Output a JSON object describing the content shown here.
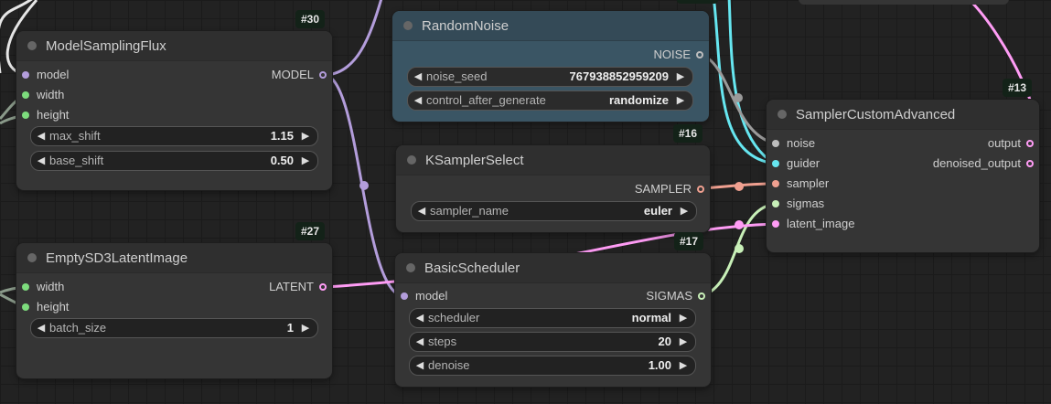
{
  "nodes": {
    "model_sampling_flux": {
      "title": "ModelSamplingFlux",
      "id": "#30",
      "inputs": [
        "model",
        "width",
        "height"
      ],
      "output": "MODEL",
      "widgets": [
        {
          "name": "max_shift",
          "value": "1.15"
        },
        {
          "name": "base_shift",
          "value": "0.50"
        }
      ]
    },
    "random_noise": {
      "title": "RandomNoise",
      "output": "NOISE",
      "widgets": [
        {
          "name": "noise_seed",
          "value": "767938852959209"
        },
        {
          "name": "control_after_generate",
          "value": "randomize"
        }
      ]
    },
    "ksampler_select": {
      "title": "KSamplerSelect",
      "id": "#16",
      "output": "SAMPLER",
      "widgets": [
        {
          "name": "sampler_name",
          "value": "euler"
        }
      ]
    },
    "empty_sd3_latent": {
      "title": "EmptySD3LatentImage",
      "id": "#27",
      "inputs": [
        "width",
        "height"
      ],
      "output": "LATENT",
      "widgets": [
        {
          "name": "batch_size",
          "value": "1"
        }
      ]
    },
    "basic_scheduler": {
      "title": "BasicScheduler",
      "id": "#17",
      "inputs": [
        "model"
      ],
      "output": "SIGMAS",
      "widgets": [
        {
          "name": "scheduler",
          "value": "normal"
        },
        {
          "name": "steps",
          "value": "20"
        },
        {
          "name": "denoise",
          "value": "1.00"
        }
      ]
    },
    "sampler_custom_advanced": {
      "title": "SamplerCustomAdvanced",
      "id": "#13",
      "inputs": [
        "noise",
        "guider",
        "sampler",
        "sigmas",
        "latent_image"
      ],
      "outputs": [
        "output",
        "denoised_output"
      ]
    }
  },
  "colors": {
    "background": "#222222",
    "node": "#353535",
    "node_blue": "#3a5564",
    "model": "#b39ddb",
    "int": "#7ddc7d",
    "noise": "#bdbdbd",
    "guider": "#66e6f0",
    "sampler": "#f0a090",
    "sigmas": "#c8f0b8",
    "latent": "#ff9cf5"
  }
}
